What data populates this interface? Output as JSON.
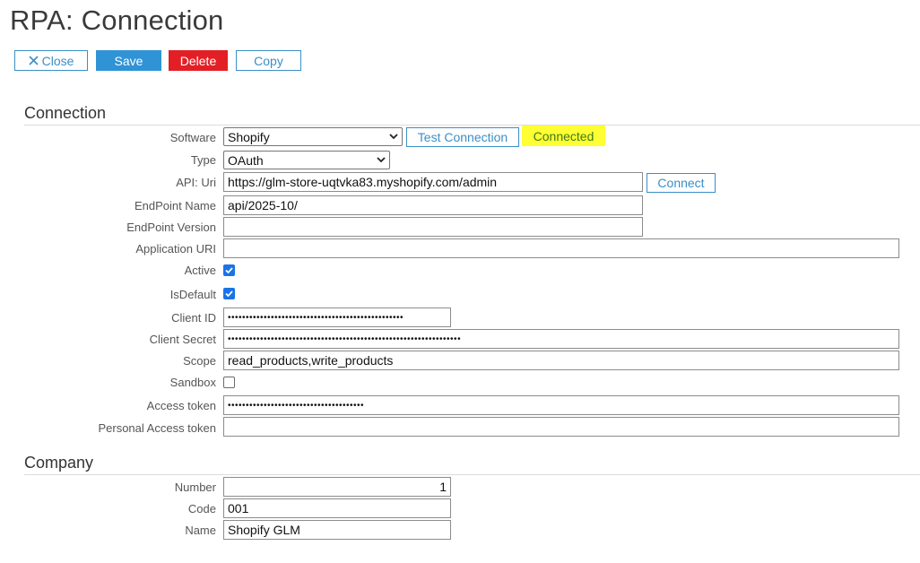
{
  "page": {
    "title": "RPA: Connection"
  },
  "toolbar": {
    "close_label": "Close",
    "save_label": "Save",
    "delete_label": "Delete",
    "copy_label": "Copy",
    "close_icon": "close-icon"
  },
  "connection": {
    "section_title": "Connection",
    "software": {
      "label": "Software",
      "value": "Shopify"
    },
    "test_connection_label": "Test Connection",
    "status_text": "Connected",
    "type": {
      "label": "Type",
      "value": "OAuth"
    },
    "api_uri": {
      "label": "API: Uri",
      "value": "https://glm-store-uqtvka83.myshopify.com/admin"
    },
    "connect_label": "Connect",
    "endpoint_name": {
      "label": "EndPoint Name",
      "value": "api/2025-10/"
    },
    "endpoint_version": {
      "label": "EndPoint Version",
      "value": ""
    },
    "application_uri": {
      "label": "Application URI",
      "value": ""
    },
    "active": {
      "label": "Active",
      "checked": true
    },
    "is_default": {
      "label": "IsDefault",
      "checked": true
    },
    "client_id": {
      "label": "Client ID",
      "value": "•••••••••••••••••••••••••••••••••••••••••••••••••"
    },
    "client_secret": {
      "label": "Client Secret",
      "value": "•••••••••••••••••••••••••••••••••••••••••••••••••••••••••••••••••"
    },
    "scope": {
      "label": "Scope",
      "value": "read_products,write_products"
    },
    "sandbox": {
      "label": "Sandbox",
      "checked": false
    },
    "access_token": {
      "label": "Access token",
      "value": "••••••••••••••••••••••••••••••••••••••"
    },
    "personal_access_token": {
      "label": "Personal Access token",
      "value": ""
    }
  },
  "company": {
    "section_title": "Company",
    "number": {
      "label": "Number",
      "value": "1"
    },
    "code": {
      "label": "Code",
      "value": "001"
    },
    "name": {
      "label": "Name",
      "value": "Shopify GLM"
    }
  },
  "colors": {
    "accent": "#2f93d6",
    "danger": "#e31f26",
    "status_bg": "#ffff33",
    "status_text": "#3c7a1a",
    "checkbox": "#1a73e8"
  }
}
